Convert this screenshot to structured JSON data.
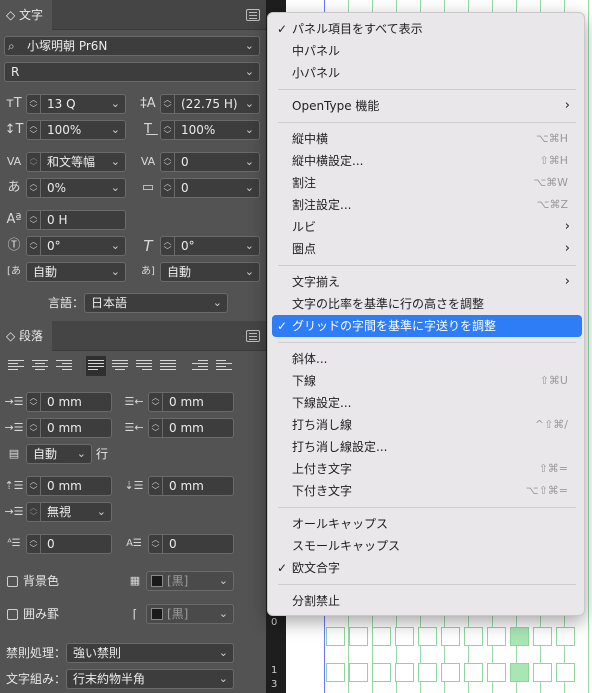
{
  "character": {
    "tab": "文字",
    "font_family": "小塚明朝 Pr6N",
    "font_style": "R",
    "size": "13 Q",
    "leading": "(22.75 H)",
    "vertical_scale": "100%",
    "horizontal_scale": "100%",
    "kerning": "和文等幅",
    "tracking": "0",
    "tsume": "0%",
    "aki": "0",
    "baseline_shift": "0 H",
    "rotation": "0°",
    "skew": "0°",
    "mojikumi_before": "自動",
    "mojikumi_after": "自動",
    "language_label": "言語：",
    "language": "日本語"
  },
  "paragraph": {
    "tab": "段落",
    "left_indent": "0 mm",
    "right_indent": "0 mm",
    "first_line_indent": "0 mm",
    "last_line_indent": "0 mm",
    "drop_lines": "自動",
    "drop_lines_unit": "行",
    "space_before": "0 mm",
    "space_after": "0 mm",
    "grid_align": "無視",
    "drop_cap_lines": "0",
    "drop_cap_chars": "0",
    "shading_label": "背景色",
    "shading_color": "[黒]",
    "border_label": "囲み罫",
    "border_color": "[黒]",
    "kinsoku_label": "禁則処理：",
    "kinsoku": "強い禁則",
    "mojikumi_label": "文字組み：",
    "mojikumi": "行末約物半角"
  },
  "ruler_marks": [
    "2",
    "0",
    "1",
    "3"
  ],
  "menu": {
    "items": [
      {
        "label": "パネル項目をすべて表示",
        "checked": true
      },
      {
        "label": "中パネル"
      },
      {
        "label": "小パネル"
      },
      {
        "label": "OpenType 機能",
        "submenu": true
      },
      {
        "label": "縦中横",
        "shortcut": "⌥⌘H"
      },
      {
        "label": "縦中横設定...",
        "shortcut": "⇧⌘H"
      },
      {
        "label": "割注",
        "shortcut": "⌥⌘W"
      },
      {
        "label": "割注設定...",
        "shortcut": "⌥⌘Z"
      },
      {
        "label": "ルビ",
        "submenu": true
      },
      {
        "label": "圏点",
        "submenu": true
      },
      {
        "label": "文字揃え",
        "submenu": true
      },
      {
        "label": "文字の比率を基準に行の高さを調整"
      },
      {
        "label": "グリッドの字間を基準に字送りを調整",
        "checked": true,
        "highlighted": true
      },
      {
        "label": "斜体..."
      },
      {
        "label": "下線",
        "shortcut": "⇧⌘U"
      },
      {
        "label": "下線設定..."
      },
      {
        "label": "打ち消し線",
        "shortcut": "^⇧⌘/"
      },
      {
        "label": "打ち消し線設定..."
      },
      {
        "label": "上付き文字",
        "shortcut": "⇧⌘="
      },
      {
        "label": "下付き文字",
        "shortcut": "⌥⇧⌘="
      },
      {
        "label": "オールキャップス"
      },
      {
        "label": "スモールキャップス"
      },
      {
        "label": "欧文合字",
        "checked": true
      },
      {
        "label": "分割禁止"
      }
    ]
  },
  "colors": {
    "panel_bg": "#535353",
    "menu_bg": "#e9e7e9",
    "highlight": "#2e7cf6",
    "grid_green": "#8fd69d",
    "grid_fill": "#a8e6b4"
  }
}
